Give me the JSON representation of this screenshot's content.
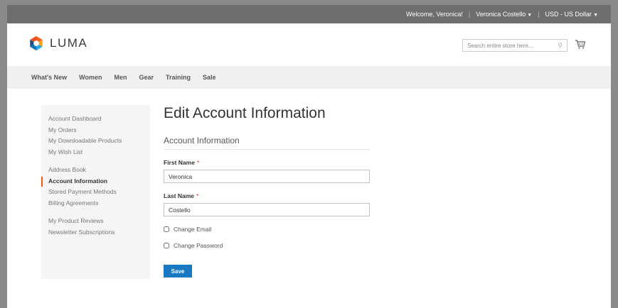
{
  "topbar": {
    "welcome": "Welcome, Veronica!",
    "customer_name": "Veronica Costello",
    "currency": "USD - US Dollar"
  },
  "header": {
    "logo_text": "LUMA",
    "search_placeholder": "Search entire store here...",
    "logo_colors": [
      "#f26322",
      "#f9a01b",
      "#2baae1",
      "#0d76bc"
    ]
  },
  "nav": {
    "items": [
      "What's New",
      "Women",
      "Men",
      "Gear",
      "Training",
      "Sale"
    ]
  },
  "sidebar": {
    "group1": [
      "Account Dashboard",
      "My Orders",
      "My Downloadable Products",
      "My Wish List"
    ],
    "group2": [
      "Address Book",
      "Account Information",
      "Stored Payment Methods",
      "Billing Agreements"
    ],
    "group3": [
      "My Product Reviews",
      "Newsletter Subscriptions"
    ],
    "active": "Account Information"
  },
  "main": {
    "page_title": "Edit Account Information",
    "section_title": "Account Information",
    "first_name_label": "First Name",
    "first_name_value": "Veronica",
    "last_name_label": "Last Name",
    "last_name_value": "Costello",
    "required_mark": "*",
    "change_email_label": "Change Email",
    "change_password_label": "Change Password",
    "save_label": "Save"
  },
  "colors": {
    "accent_orange": "#ff5501",
    "button_blue": "#1979c3",
    "required_red": "#e02b27"
  }
}
